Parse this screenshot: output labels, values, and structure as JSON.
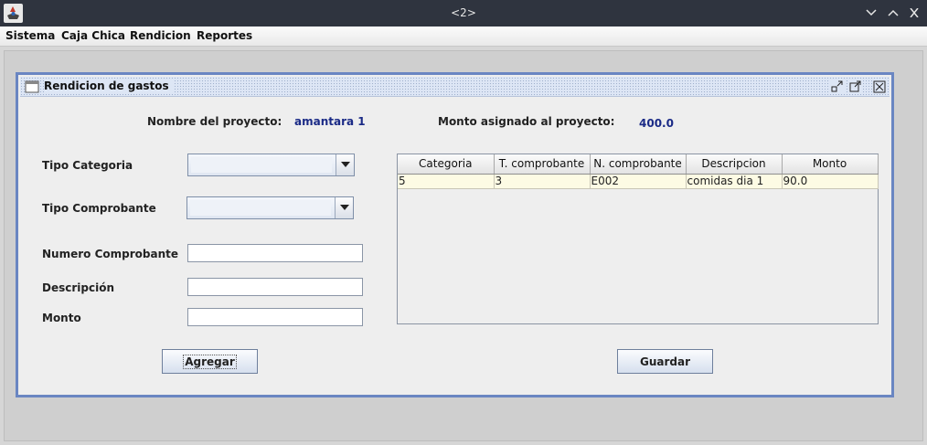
{
  "window": {
    "title": "<2>",
    "controls": {
      "minimize": "chevron-down-icon",
      "maximize": "chevron-up-icon",
      "close": "close-icon"
    }
  },
  "menu": [
    "Sistema",
    "Caja Chica",
    "Rendicion",
    "Reportes"
  ],
  "frame": {
    "title": "Rendicion de gastos",
    "controls": [
      "iconify-icon",
      "maximize-icon",
      "close-icon"
    ]
  },
  "project": {
    "name_label": "Nombre del proyecto:",
    "name_value": "amantara 1",
    "amount_label": "Monto asignado al proyecto:",
    "amount_value": "400.0"
  },
  "form": {
    "tipo_categoria_label": "Tipo Categoria",
    "tipo_categoria_value": "",
    "tipo_comprobante_label": "Tipo Comprobante",
    "tipo_comprobante_value": "",
    "numero_label": "Numero Comprobante",
    "numero_value": "",
    "descripcion_label": "Descripción",
    "descripcion_value": "",
    "monto_label": "Monto",
    "monto_value": ""
  },
  "table": {
    "columns": [
      "Categoria",
      "T. comprobante",
      "N. comprobante",
      "Descripcion",
      "Monto"
    ],
    "rows": [
      [
        "5",
        "3",
        "E002",
        "comidas dia 1",
        "90.0"
      ]
    ]
  },
  "buttons": {
    "agregar": "Agregar",
    "guardar": "Guardar"
  },
  "colors": {
    "titlebar": "#2f343f",
    "frame_border": "#6a86c2",
    "value_text": "#1a2a86",
    "row_bg": "#fdfbe4"
  }
}
